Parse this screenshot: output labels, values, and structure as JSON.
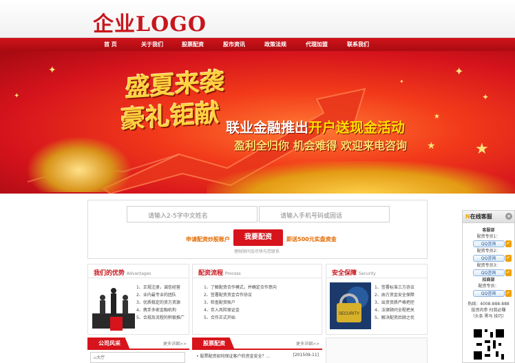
{
  "header": {
    "logo": "企业LOGO"
  },
  "nav": {
    "items": [
      "首 页",
      "关于我们",
      "股票配资",
      "股市资讯",
      "政策法规",
      "代理加盟",
      "联系我们"
    ]
  },
  "banner": {
    "title1": "盛夏来袭",
    "title2": "豪礼钜献",
    "promo_prefix": "联业金融推出",
    "promo_highlight": "开户送现金活动",
    "promo_line2": "盈利全归你 机会难得 欢迎来电咨询"
  },
  "form": {
    "name_placeholder": "请输入2-5字中文姓名",
    "phone_placeholder": "请输入手机号码或固话",
    "left_text": "申请配资炒股账户",
    "button": "我要配资",
    "right_text": "即送500元实盘资金",
    "note": "理财顾问会尽快与您联系"
  },
  "panels": {
    "advantages": {
      "title": "我们的优势",
      "title_en": "Advantages",
      "items": [
        "1、正规注册，诚信经营",
        "2、业内最专业的团队",
        "3、优质稳定的资方资源",
        "4、携手多家金融机构",
        "5、合规及流程的积极推广"
      ]
    },
    "process": {
      "title": "配资流程",
      "title_en": "Process",
      "items": [
        "1、了解配资合作模式，并确定合作意向",
        "2、签署配资资金合作协议",
        "3、检查配资账户",
        "4、存入风险保证金",
        "5、合作正式开始"
      ]
    },
    "security": {
      "title": "安全保障",
      "title_en": "Security",
      "image_label": "SECURITY",
      "items": [
        "1、签署标准三方协议",
        "2、由方资金安全保障",
        "3、出资资质严格把控",
        "4、法律顾问全程把关",
        "5、解决配资后顾之忧"
      ]
    }
  },
  "bottom": {
    "company": {
      "title": "公司风采",
      "more": "更多详细>>",
      "image_alt": "大厅"
    },
    "news": {
      "title": "股票配资",
      "more": "更多详细>>",
      "item": "股票配资如何保证客户的资金安全？...",
      "date": "[201509-11]"
    }
  },
  "customer_service": {
    "title": "在线客服",
    "close_icon": "close-icon",
    "dept1": "客服部",
    "agent1": "配资专员1：",
    "agent2": "配资专员2：",
    "agent3": "配资专员3：",
    "dept2": "招商部",
    "agent4": "配资专员：",
    "qq_label": "QQ咨询",
    "hotline": "热线：4008-888-888",
    "qr_text1": "投资内参 扫我必赚",
    "qr_text2": "（头条 黑马 技巧）"
  },
  "colors": {
    "brand_red": "#d7141c",
    "accent_orange": "#e36a00"
  }
}
